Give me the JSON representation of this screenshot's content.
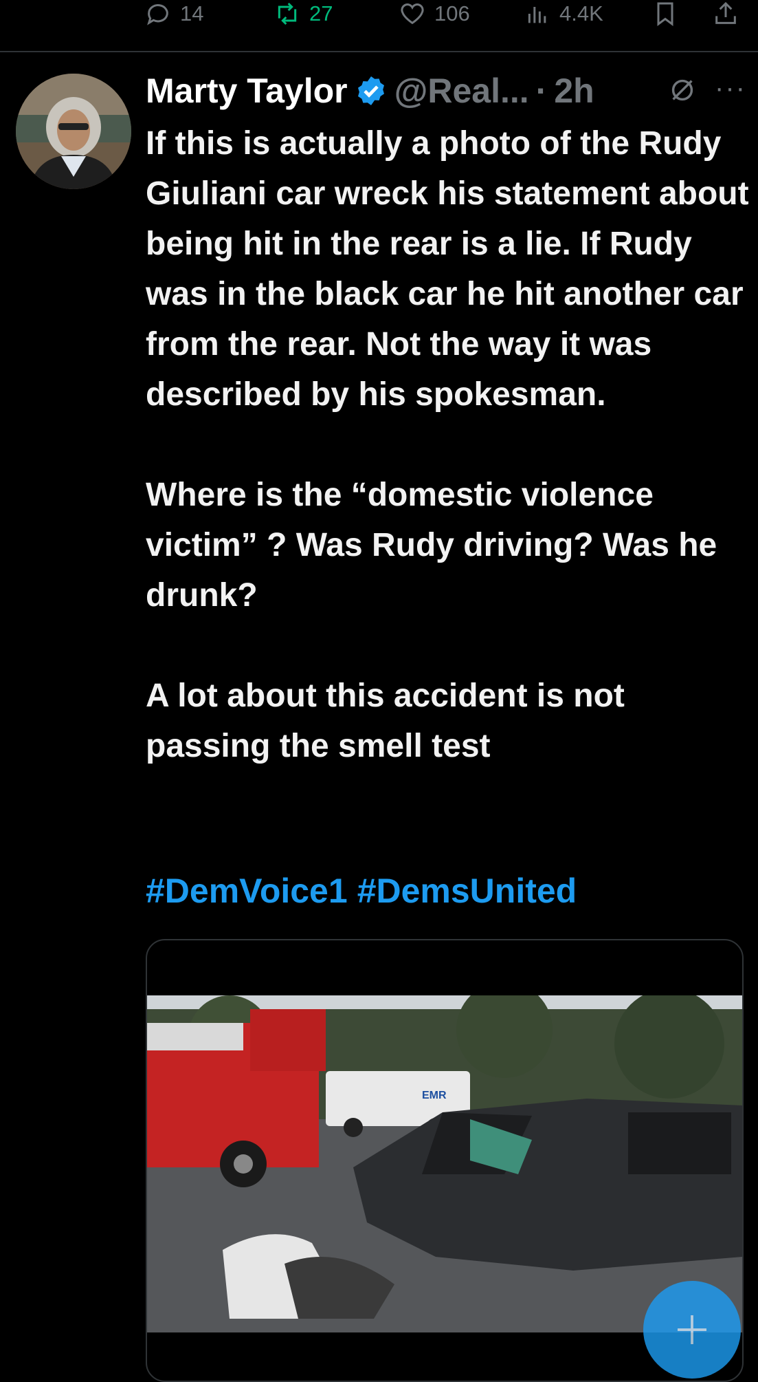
{
  "actions": {
    "replies": "14",
    "retweets": "27",
    "likes": "106",
    "views": "4.4K"
  },
  "tweet": {
    "author_name": "Marty Taylor",
    "handle": "@Real...",
    "separator": "·",
    "time": "2h",
    "paragraphs": [
      "If this is actually a photo of the Rudy Giuliani car wreck his statement about being hit in the rear is a lie. If Rudy was in the black car he hit another car from the rear. Not the way it was described by his spokesman.",
      "Where is the “domestic violence victim” ? Was Rudy driving? Was he drunk?",
      "A lot about this accident is not passing the smell test"
    ],
    "hashtags": [
      "#DemVoice1",
      "#DemsUnited"
    ],
    "media_caption_text": "EMR"
  },
  "colors": {
    "background": "#000000",
    "text": "#e7e9ea",
    "muted": "#71767b",
    "link": "#1d9bf0",
    "retweet_active": "#00ba7c"
  },
  "icons": {
    "reply": "reply-icon",
    "retweet": "retweet-icon",
    "like": "heart-icon",
    "views": "views-icon",
    "bookmark": "bookmark-icon",
    "share": "share-icon",
    "verified": "verified-badge-icon",
    "grok": "grok-icon",
    "more": "more-icon",
    "compose": "plus-icon"
  }
}
